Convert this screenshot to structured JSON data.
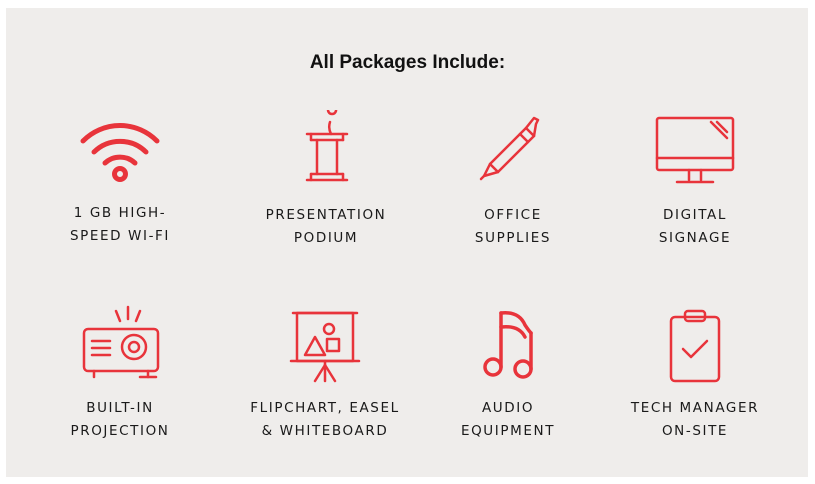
{
  "header": {
    "title": "All Packages Include:"
  },
  "accent_color": "#e8343b",
  "items": [
    {
      "icon": "wifi-icon",
      "line1": "1 GB HIGH-",
      "line2": "SPEED WI-FI"
    },
    {
      "icon": "podium-icon",
      "line1": "PRESENTATION",
      "line2": "PODIUM"
    },
    {
      "icon": "pencil-icon",
      "line1": "OFFICE",
      "line2": "SUPPLIES"
    },
    {
      "icon": "monitor-icon",
      "line1": "DIGITAL",
      "line2": "SIGNAGE"
    },
    {
      "icon": "projector-icon",
      "line1": "BUILT-IN",
      "line2": "PROJECTION"
    },
    {
      "icon": "easel-icon",
      "line1": "FLIPCHART, EASEL",
      "line2": "& WHITEBOARD"
    },
    {
      "icon": "music-note-icon",
      "line1": "AUDIO",
      "line2": "EQUIPMENT"
    },
    {
      "icon": "clipboard-check-icon",
      "line1": "TECH MANAGER",
      "line2": "ON-SITE"
    }
  ]
}
